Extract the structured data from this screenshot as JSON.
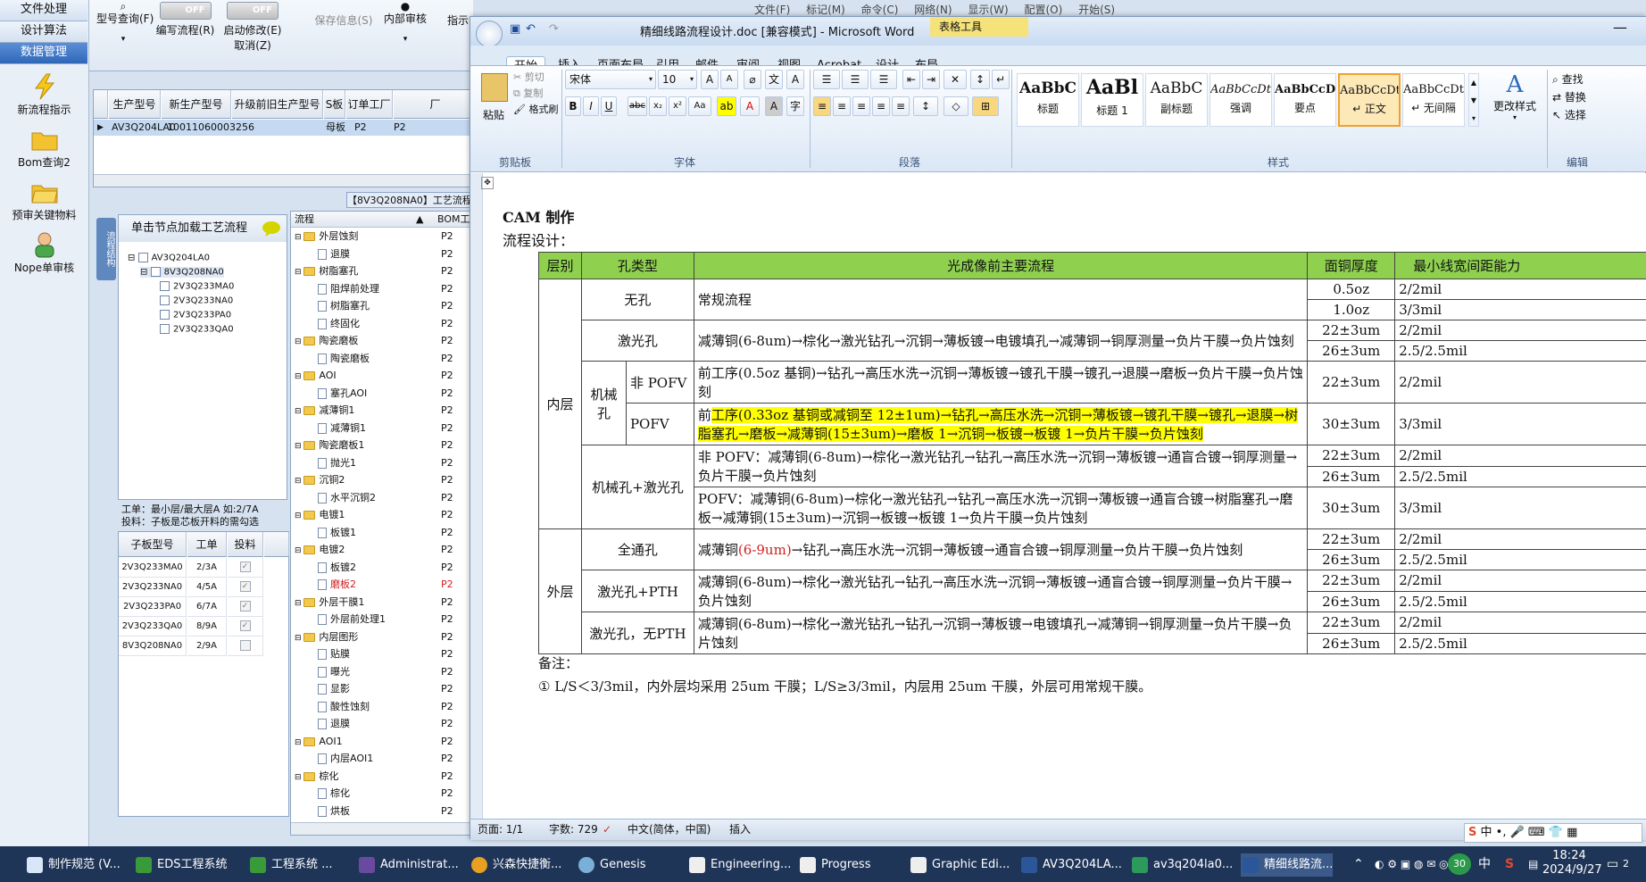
{
  "left_nav": {
    "buttons": [
      "文件处理",
      "设计算法",
      "数据管理"
    ],
    "tools": [
      "新流程指示",
      "Bom查询2",
      "预审关键物料",
      "Nope单审核"
    ]
  },
  "toolbar": {
    "model_query": "型号查询(F)",
    "edit_flow": "编写流程(R)",
    "edit_flow_toggle": "OFF",
    "start_modify": "启动修改(E)",
    "start_modify_toggle": "OFF",
    "cancel": "取消(Z)",
    "save_info": "保存信息(S)",
    "internal_review": "内部审核",
    "instruct": "指示"
  },
  "grid": {
    "headers": [
      "生产型号",
      "新生产型号",
      "升级前旧生产型号",
      "S板",
      "订单工厂",
      "厂"
    ],
    "row": [
      "AV3Q204LA0",
      "10011060003256",
      "",
      "母板",
      "P2",
      "P2"
    ]
  },
  "process_header": "【8V3Q208NA0】工艺流程",
  "side_tab": "流程结构",
  "tree_panel": {
    "title": "单击节点加载工艺流程",
    "nodes": [
      "AV3Q204LA0",
      "8V3Q208NA0",
      "2V3Q233MA0",
      "2V3Q233NA0",
      "2V3Q233PA0",
      "2V3Q233QA0"
    ]
  },
  "notes": {
    "line1": "工单：最小层/最大层A 如:2/7A",
    "line2": "投料：子板是芯板开料的需勾选"
  },
  "sub_table": {
    "headers": [
      "子板型号",
      "工单",
      "投料"
    ],
    "rows": [
      {
        "model": "2V3Q233MA0",
        "order": "2/3A",
        "checked": true
      },
      {
        "model": "2V3Q233NA0",
        "order": "4/5A",
        "checked": true
      },
      {
        "model": "2V3Q233PA0",
        "order": "6/7A",
        "checked": true
      },
      {
        "model": "2V3Q233QA0",
        "order": "8/9A",
        "checked": true
      },
      {
        "model": "8V3Q208NA0",
        "order": "2/9A",
        "checked": false
      }
    ]
  },
  "process_tree": {
    "header_flow": "流程",
    "header_bom": "BOM工",
    "rows": [
      {
        "type": "folder",
        "label": "外层蚀刻",
        "code": "P2"
      },
      {
        "type": "item",
        "label": "退膜",
        "code": "P2"
      },
      {
        "type": "folder",
        "label": "树脂塞孔",
        "code": "P2"
      },
      {
        "type": "item",
        "label": "阻焊前处理",
        "code": "P2"
      },
      {
        "type": "item",
        "label": "树脂塞孔",
        "code": "P2"
      },
      {
        "type": "item",
        "label": "终固化",
        "code": "P2"
      },
      {
        "type": "folder",
        "label": "陶瓷磨板",
        "code": "P2"
      },
      {
        "type": "item",
        "label": "陶瓷磨板",
        "code": "P2"
      },
      {
        "type": "folder",
        "label": "AOI",
        "code": "P2"
      },
      {
        "type": "item",
        "label": "塞孔AOI",
        "code": "P2"
      },
      {
        "type": "folder",
        "label": "减薄铜1",
        "code": "P2"
      },
      {
        "type": "item",
        "label": "减薄铜1",
        "code": "P2"
      },
      {
        "type": "folder",
        "label": "陶瓷磨板1",
        "code": "P2"
      },
      {
        "type": "item",
        "label": "抛光1",
        "code": "P2"
      },
      {
        "type": "folder",
        "label": "沉铜2",
        "code": "P2"
      },
      {
        "type": "item",
        "label": "水平沉铜2",
        "code": "P2"
      },
      {
        "type": "folder",
        "label": "电镀1",
        "code": "P2"
      },
      {
        "type": "item",
        "label": "板镀1",
        "code": "P2"
      },
      {
        "type": "folder",
        "label": "电镀2",
        "code": "P2"
      },
      {
        "type": "item",
        "label": "板镀2",
        "code": "P2"
      },
      {
        "type": "item",
        "label": "磨板2",
        "code": "P2",
        "red": true
      },
      {
        "type": "folder",
        "label": "外层干膜1",
        "code": "P2"
      },
      {
        "type": "item",
        "label": "外层前处理1",
        "code": "P2"
      },
      {
        "type": "folder",
        "label": "内层图形",
        "code": "P2"
      },
      {
        "type": "item",
        "label": "贴膜",
        "code": "P2"
      },
      {
        "type": "item",
        "label": "曝光",
        "code": "P2"
      },
      {
        "type": "item",
        "label": "显影",
        "code": "P2"
      },
      {
        "type": "item",
        "label": "酸性蚀刻",
        "code": "P2"
      },
      {
        "type": "item",
        "label": "退膜",
        "code": "P2"
      },
      {
        "type": "folder",
        "label": "AOI1",
        "code": "P2"
      },
      {
        "type": "item",
        "label": "内层AOI1",
        "code": "P2"
      },
      {
        "type": "folder",
        "label": "棕化",
        "code": "P2"
      },
      {
        "type": "item",
        "label": "棕化",
        "code": "P2"
      },
      {
        "type": "item",
        "label": "烘板",
        "code": "P2"
      }
    ]
  },
  "bg_menu": [
    "文件(F)",
    "标记(M)",
    "命令(C)",
    "网络(N)",
    "显示(W)",
    "配置(O)",
    "开始(S)"
  ],
  "word": {
    "title": "精细线路流程设计.doc [兼容模式] - Microsoft Word",
    "context_tab": "表格工具",
    "tabs": [
      "开始",
      "插入",
      "页面布局",
      "引用",
      "邮件",
      "审阅",
      "视图",
      "Acrobat",
      "设计",
      "布局"
    ],
    "clipboard": {
      "paste": "粘贴",
      "cut": "剪切",
      "copy": "复制",
      "format_painter": "格式刷",
      "label": "剪贴板"
    },
    "font": {
      "name": "宋体",
      "size": "10",
      "label": "字体"
    },
    "paragraph_label": "段落",
    "styles": [
      {
        "sample": "AaBbC",
        "name": "标题"
      },
      {
        "sample": "AaBl",
        "name": "标题 1"
      },
      {
        "sample": "AaBbC",
        "name": "副标题"
      },
      {
        "sample": "AaBbCcDt",
        "name": "强调"
      },
      {
        "sample": "AaBbCcD",
        "name": "要点"
      },
      {
        "sample": "AaBbCcDt",
        "name": "↵ 正文"
      },
      {
        "sample": "AaBbCcDt",
        "name": "↵ 无间隔"
      }
    ],
    "change_styles": "更改样式",
    "styles_label": "样式",
    "editing": {
      "find": "查找",
      "replace": "替换",
      "select": "选择",
      "label": "编辑"
    },
    "doc_heading": "CAM 制作",
    "subheading": "流程设计：",
    "table": {
      "headers": [
        "层别",
        "孔类型",
        "光成像前主要流程",
        "面铜厚度",
        "最小线宽间距能力"
      ],
      "layer_inner": "内层",
      "layer_outer": "外层",
      "none_hole": "无孔",
      "regular": "常规流程",
      "laser_hole": "激光孔",
      "laser_flow": "减薄铜(6-8um)→棕化→激光钻孔→沉铜→薄板镀→电镀填孔→减薄铜→铜厚测量→负片干膜→负片蚀刻",
      "mech_hole": "机械孔",
      "non_pofv": "非 POFV",
      "non_pofv_flow": "前工序(0.5oz 基铜)→钻孔→高压水洗→沉铜→薄板镀→镀孔干膜→镀孔→退膜→磨板→负片干膜→负片蚀刻",
      "pofv": "POFV",
      "pofv_flow_a": "前",
      "pofv_flow_b": "工序(0.33oz 基铜或减铜至 12±1um)→钻孔→高压水洗→沉铜→薄板镀→镀孔干膜→镀孔→退膜→树脂塞孔→磨板→减薄铜(15±3um)→磨板 1→沉铜→板镀→板镀 1→负片干膜→负片蚀刻",
      "mech_laser": "机械孔+激光孔",
      "ml_non_pofv": "非 POFV：减薄铜(6-8um)→棕化→激光钻孔→钻孔→高压水洗→沉铜→薄板镀→通盲合镀→铜厚测量→负片干膜→负片蚀刻",
      "ml_pofv": "POFV：减薄铜(6-8um)→棕化→激光钻孔→钻孔→高压水洗→沉铜→薄板镀→通盲合镀→树脂塞孔→磨板→减薄铜(15±3um)→沉铜→板镀→板镀 1→负片干膜→负片蚀刻",
      "through": "全通孔",
      "through_flow_a": "减薄铜",
      "through_flow_red": "(6-9um)",
      "through_flow_b": "→钻孔→高压水洗→沉铜→薄板镀→通盲合镀→铜厚测量→负片干膜→负片蚀刻",
      "laser_pth": "激光孔+PTH",
      "laser_pth_flow": "减薄铜(6-8um)→棕化→激光钻孔→钻孔→高压水洗→沉铜→薄板镀→通盲合镀→铜厚测量→负片干膜→负片蚀刻",
      "laser_nopth": "激光孔，无PTH",
      "laser_nopth_flow": "减薄铜(6-8um)→棕化→激光钻孔→钻孔→沉铜→薄板镀→电镀填孔→减薄铜→铜厚测量→负片干膜→负片蚀刻",
      "cu": [
        "0.5oz",
        "1.0oz",
        "22±3um",
        "26±3um",
        "22±3um",
        "30±3um",
        "22±3um",
        "26±3um",
        "30±3um",
        "22±3um",
        "26±3um",
        "22±3um",
        "26±3um",
        "22±3um",
        "26±3um"
      ],
      "ls": [
        "2/2mil",
        "3/3mil",
        "2/2mil",
        "2.5/2.5mil",
        "2/2mil",
        "3/3mil",
        "2/2mil",
        "2.5/2.5mil",
        "3/3mil",
        "2/2mil",
        "2.5/2.5mil",
        "2/2mil",
        "2.5/2.5mil",
        "2/2mil",
        "2.5/2.5mil"
      ]
    },
    "remark": "备注：",
    "remark_1": "① L/S＜3/3mil，内外层均采用 25um 干膜；L/S≥3/3mil，内层用 25um 干膜，外层可用常规干膜。",
    "status": {
      "page": "页面: 1/1",
      "words": "字数: 729",
      "lang": "中文(简体，中国)",
      "mode": "插入"
    }
  },
  "taskbar": {
    "items": [
      "制作规范 (V...",
      "EDS工程系统",
      "工程系统 ...",
      "Administrat...",
      "兴森快捷衡...",
      "Genesis",
      "Engineering...",
      "Progress",
      "Graphic Edi...",
      "AV3Q204LA...",
      "av3q204la0...",
      "精细线路流..."
    ],
    "time": "18:24",
    "date": "2024/9/27",
    "ime": "中",
    "badge": "30",
    "notif": "2"
  },
  "colors": {
    "header_green": "#8fd14f",
    "highlight": "#ffff00",
    "taskbar": "#1f3558",
    "accent": "#2f67b8"
  }
}
